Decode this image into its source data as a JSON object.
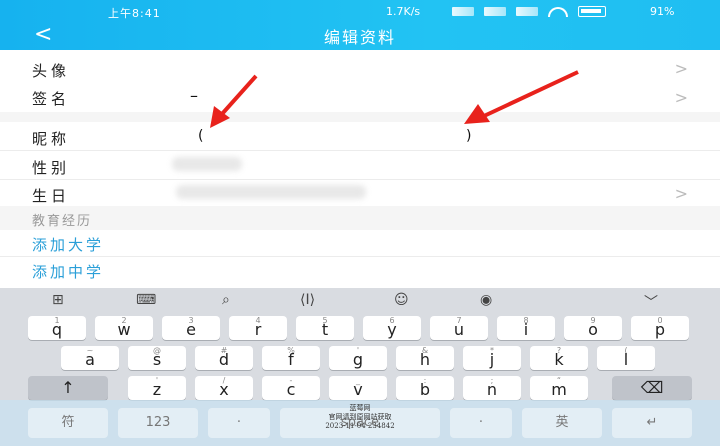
{
  "status": {
    "time": "上午8:41",
    "speed": "1.7K/s",
    "battery": "91%"
  },
  "header": {
    "back": "<",
    "title": "编辑资料"
  },
  "rows": {
    "avatar": "头像",
    "signature": "签名",
    "signature_value": "–",
    "nickname": "昵称",
    "nickname_open": "(",
    "nickname_close": ")",
    "gender": "性别",
    "birthday": "生日"
  },
  "education": {
    "section": "教育经历",
    "add_college": "添加大学",
    "add_highschool": "添加中学"
  },
  "chevron": ">",
  "keyboard": {
    "row1": [
      [
        "1",
        "q"
      ],
      [
        "2",
        "w"
      ],
      [
        "3",
        "e"
      ],
      [
        "4",
        "r"
      ],
      [
        "5",
        "t"
      ],
      [
        "6",
        "y"
      ],
      [
        "7",
        "u"
      ],
      [
        "8",
        "i"
      ],
      [
        "9",
        "o"
      ],
      [
        "0",
        "p"
      ]
    ],
    "row2": [
      [
        "~",
        "a"
      ],
      [
        "@",
        "s"
      ],
      [
        "#",
        "d"
      ],
      [
        "%",
        "f"
      ],
      [
        "'",
        "g"
      ],
      [
        "&",
        "h"
      ],
      [
        "*",
        "j"
      ],
      [
        "?",
        "k"
      ],
      [
        "(",
        "l"
      ]
    ],
    "row3": [
      [
        "'",
        "z"
      ],
      [
        "/",
        "x"
      ],
      [
        "-",
        "c"
      ],
      [
        "_",
        "v"
      ],
      [
        ":",
        "b"
      ],
      [
        ";",
        "n"
      ],
      [
        "“",
        "m"
      ]
    ],
    "bottom": [
      "符",
      "123",
      "·",
      "space",
      "·",
      "英",
      "↵"
    ]
  },
  "watermark": {
    "line1": "蓝莓网",
    "line2": "官网请到原网站获取",
    "line3": "2023-11-04 234842"
  },
  "accent": "#2a9fd8"
}
